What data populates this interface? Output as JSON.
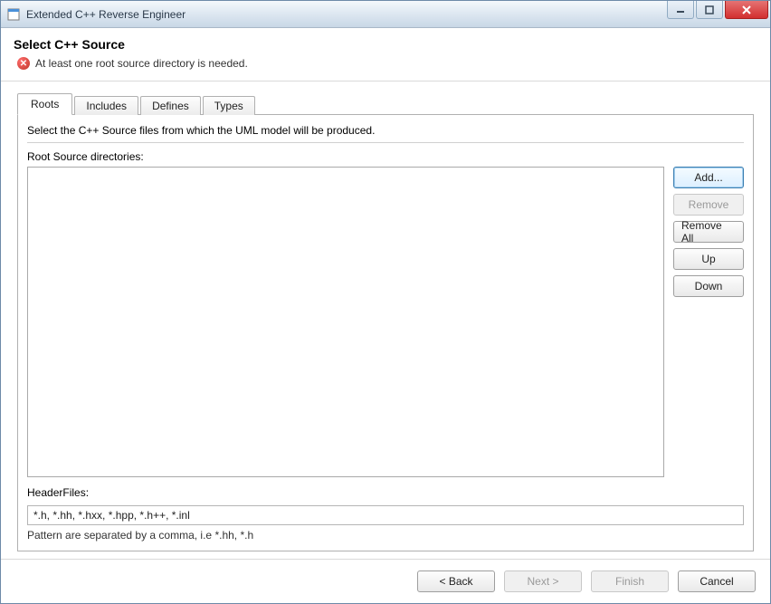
{
  "window": {
    "title": "Extended C++ Reverse Engineer"
  },
  "header": {
    "title": "Select C++ Source",
    "error_message": "At least one root source directory is needed."
  },
  "tabs": [
    {
      "label": "Roots",
      "active": true
    },
    {
      "label": "Includes",
      "active": false
    },
    {
      "label": "Defines",
      "active": false
    },
    {
      "label": "Types",
      "active": false
    }
  ],
  "panel": {
    "description": "Select the C++ Source files from which the UML model will be produced.",
    "root_dirs_label": "Root Source directories:",
    "buttons": {
      "add": "Add...",
      "remove": "Remove",
      "remove_all": "Remove All",
      "up": "Up",
      "down": "Down"
    },
    "headerfiles_label": "HeaderFiles:",
    "headerfiles_value": "*.h, *.hh, *.hxx, *.hpp, *.h++, *.inl",
    "pattern_hint": "Pattern are separated by a comma, i.e *.hh, *.h"
  },
  "footer": {
    "back": "< Back",
    "next": "Next >",
    "finish": "Finish",
    "cancel": "Cancel"
  }
}
